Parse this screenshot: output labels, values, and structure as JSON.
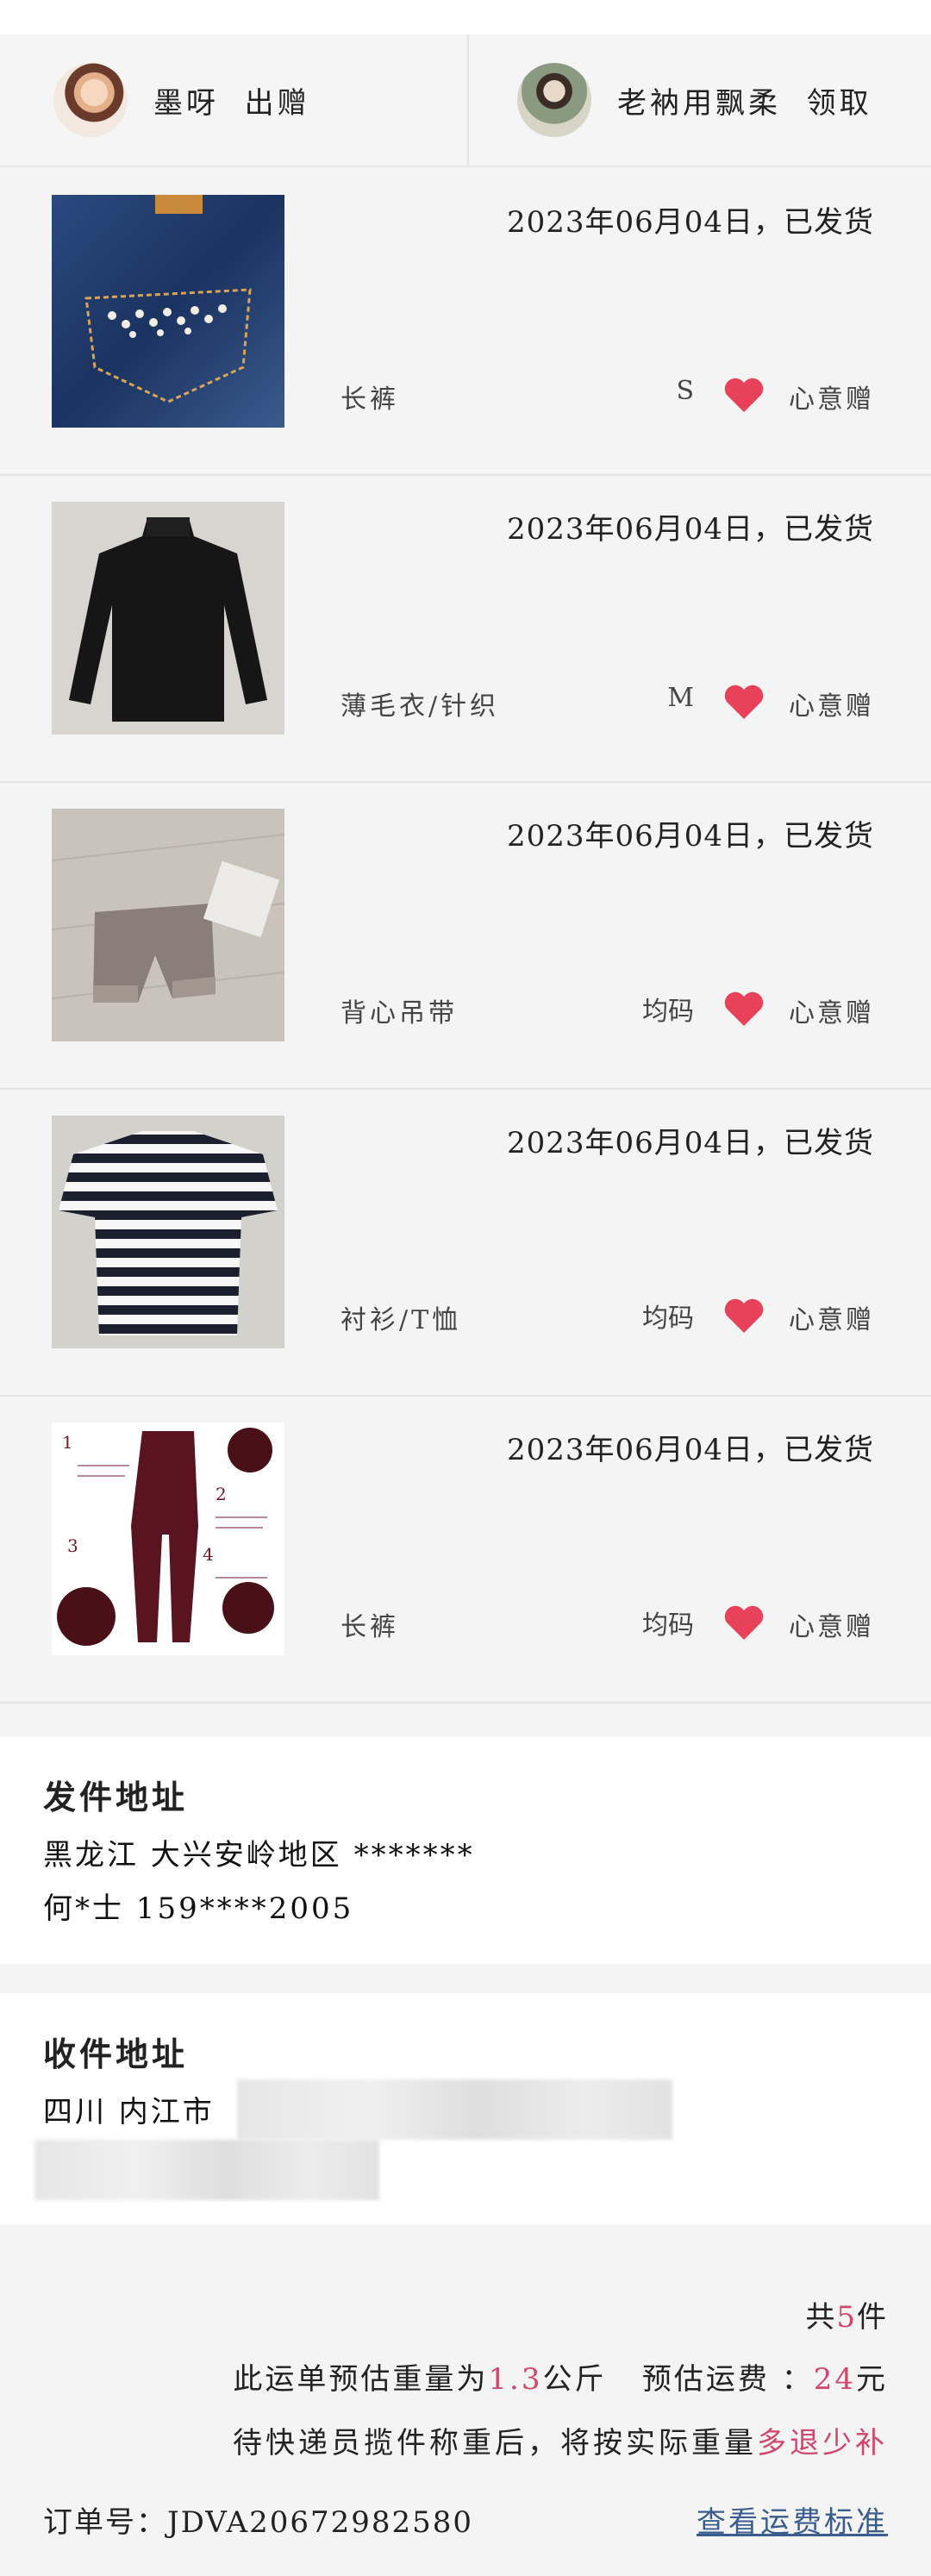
{
  "header": {
    "giver": {
      "name": "墨呀",
      "action": "出赠"
    },
    "receiver": {
      "name": "老衲用飘柔",
      "action": "领取"
    }
  },
  "items": [
    {
      "date": "2023年06月04日，已发货",
      "category": "长裤",
      "size": "S",
      "gift_label": "心意赠",
      "image": "denim-jeans-photo"
    },
    {
      "date": "2023年06月04日，已发货",
      "category": "薄毛衣/针织",
      "size": "M",
      "gift_label": "心意赠",
      "image": "black-sweater-photo"
    },
    {
      "date": "2023年06月04日，已发货",
      "category": "背心吊带",
      "size": "均码",
      "gift_label": "心意赠",
      "image": "shorts-photo"
    },
    {
      "date": "2023年06月04日，已发货",
      "category": "衬衫/T恤",
      "size": "均码",
      "gift_label": "心意赠",
      "image": "striped-tshirt-photo"
    },
    {
      "date": "2023年06月04日，已发货",
      "category": "长裤",
      "size": "均码",
      "gift_label": "心意赠",
      "image": "tights-photo"
    }
  ],
  "sender": {
    "title": "发件地址",
    "region": "黑龙江  大兴安岭地区  *******",
    "contact": "何*士  159****2005"
  },
  "recipient": {
    "title": "收件地址",
    "region": "四川  内江市"
  },
  "summary": {
    "total_prefix": "共",
    "total_count": "5",
    "total_suffix": "件",
    "weight_prefix": "此运单预估重量为",
    "weight_value": "1.3",
    "weight_unit": "公斤",
    "fee_label": "预估运费 ：",
    "fee_value": "24",
    "fee_unit": "元",
    "notice_text": "待快递员揽件称重后，将按实际重量",
    "notice_highlight": "多退少补",
    "order_label": "订单号：",
    "order_number": "JDVA20672982580",
    "view_standard": "查看运费标准"
  },
  "colors": {
    "accent": "#d0466c",
    "heart": "#e8415a",
    "link": "#3a5d8f",
    "background": "#f4f4f4"
  }
}
